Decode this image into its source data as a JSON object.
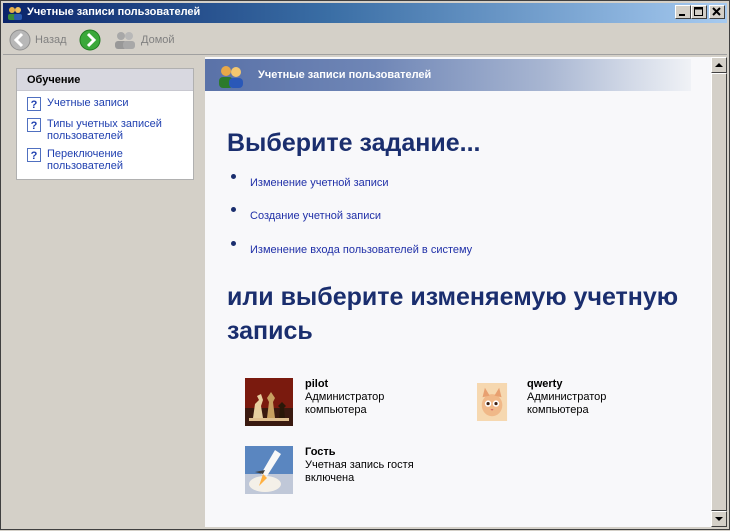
{
  "window": {
    "title": "Учетные записи пользователей"
  },
  "toolbar": {
    "back_label": "Назад",
    "home_label": "Домой"
  },
  "learn": {
    "heading": "Обучение",
    "items": [
      {
        "label": "Учетные записи"
      },
      {
        "label": "Типы учетных записей пользователей"
      },
      {
        "label": "Переключение пользователей"
      }
    ]
  },
  "banner": {
    "title": "Учетные записи пользователей"
  },
  "main": {
    "heading_tasks": "Выберите задание...",
    "tasks": [
      {
        "label": "Изменение учетной записи"
      },
      {
        "label": "Создание учетной записи"
      },
      {
        "label": "Изменение входа пользователей в систему"
      }
    ],
    "heading_accounts_line1": "или выберите изменяемую учетную",
    "heading_accounts_line2": "запись",
    "accounts": [
      {
        "name": "pilot",
        "desc1": "Администратор",
        "desc2": "компьютера",
        "picture": "chess-picture"
      },
      {
        "name": "qwerty",
        "desc1": "Администратор",
        "desc2": "компьютера",
        "picture": "kitten-picture"
      },
      {
        "name": "Гость",
        "desc1": "Учетная запись гостя",
        "desc2": "включена",
        "picture": "space-shuttle-picture"
      }
    ]
  },
  "colors": {
    "heading": "#1a2e6e",
    "link": "#2030a8",
    "titlebar": "#0a246a"
  }
}
